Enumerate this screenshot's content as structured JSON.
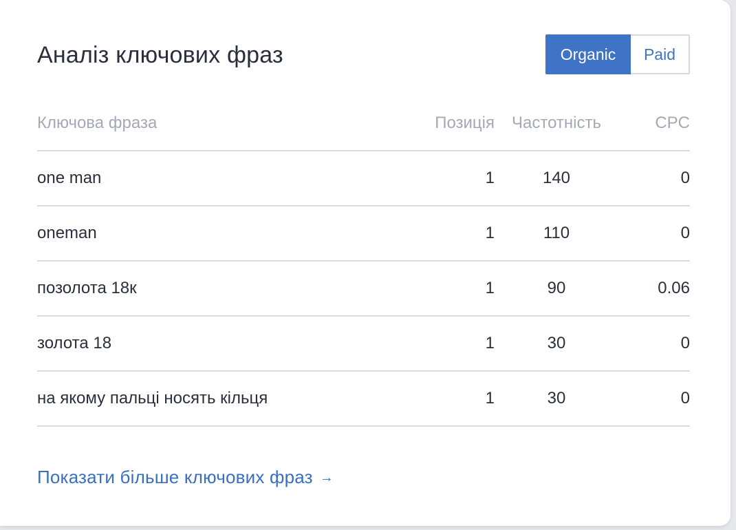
{
  "widget": {
    "title": "Аналіз ключових фраз",
    "toggle": {
      "organic_label": "Organic",
      "paid_label": "Paid",
      "selected": "Organic"
    }
  },
  "table": {
    "headers": {
      "phrase": "Ключова фраза",
      "position": "Позиція",
      "frequency": "Частотність",
      "cpc": "CPC"
    },
    "rows": [
      {
        "phrase": "one man",
        "position": "1",
        "frequency": "140",
        "cpc": "0"
      },
      {
        "phrase": "oneman",
        "position": "1",
        "frequency": "110",
        "cpc": "0"
      },
      {
        "phrase": "позолота 18к",
        "position": "1",
        "frequency": "90",
        "cpc": "0.06"
      },
      {
        "phrase": "золота 18",
        "position": "1",
        "frequency": "30",
        "cpc": "0"
      },
      {
        "phrase": "на якому пальці носять кільця",
        "position": "1",
        "frequency": "30",
        "cpc": "0"
      }
    ]
  },
  "footer": {
    "more_link_label": "Показати більше ключових фраз",
    "more_link_icon": "arrow-right-icon"
  },
  "colors": {
    "accent": "#3f73c5",
    "text": "#2a2f3c",
    "muted": "#a3a9b6",
    "divider": "#d7dbe3"
  }
}
